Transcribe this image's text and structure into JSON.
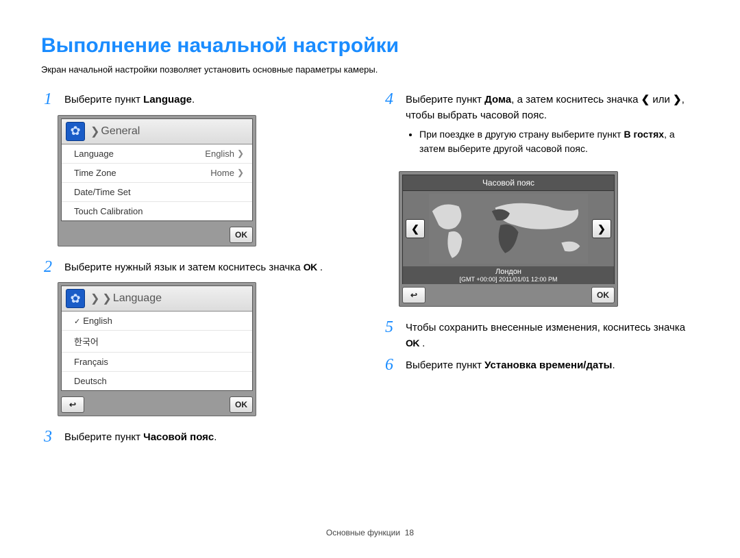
{
  "title": "Выполнение начальной настройки",
  "subtitle": "Экран начальной настройки позволяет установить основные параметры камеры.",
  "left": {
    "step1_pre": "Выберите пункт ",
    "step1_bold": "Language",
    "step1_post": ".",
    "step2_pre": "Выберите нужный язык и затем коснитесь значка ",
    "step2_ok": "OK",
    "step2_post": " .",
    "step3_pre": "Выберите пункт ",
    "step3_bold": "Часовой пояс",
    "step3_post": "."
  },
  "right": {
    "step4_pre": "Выберите пункт ",
    "step4_b1": "Дома",
    "step4_mid": ", а затем коснитесь значка ",
    "step4_or": " или ",
    "step4_end": ", чтобы выбрать часовой пояс.",
    "step4_bullet_pre": "При поездке в другую страну выберите пункт ",
    "step4_bullet_bold": "В гостях",
    "step4_bullet_post": ", а затем выберите другой часовой пояс.",
    "step5_pre": "Чтобы сохранить внесенные изменения, коснитесь значка ",
    "step5_ok": "OK",
    "step5_post": " .",
    "step6_pre": "Выберите пункт ",
    "step6_bold": "Установка времени/даты",
    "step6_post": "."
  },
  "nums": {
    "n1": "1",
    "n2": "2",
    "n3": "3",
    "n4": "4",
    "n5": "5",
    "n6": "6"
  },
  "panel_general": {
    "header": "General",
    "items": [
      {
        "label": "Language",
        "value": "English"
      },
      {
        "label": "Time Zone",
        "value": "Home"
      },
      {
        "label": "Date/Time Set",
        "value": ""
      },
      {
        "label": "Touch Calibration",
        "value": ""
      }
    ],
    "ok": "OK"
  },
  "panel_language": {
    "header": "Language",
    "items": [
      "English",
      "한국어",
      "Français",
      "Deutsch"
    ],
    "ok": "OK"
  },
  "tz": {
    "header": "Часовой пояс",
    "city": "Лондон",
    "gmt": "[GMT +00:00] 2011/01/01 12:00 PM",
    "ok": "OK"
  },
  "footer_label": "Основные функции",
  "footer_page": "18",
  "icons": {
    "gear": "✿",
    "chev_r": "❯",
    "chev_l": "❮",
    "chev_sm": "›",
    "check": "✓",
    "back": "↩"
  }
}
